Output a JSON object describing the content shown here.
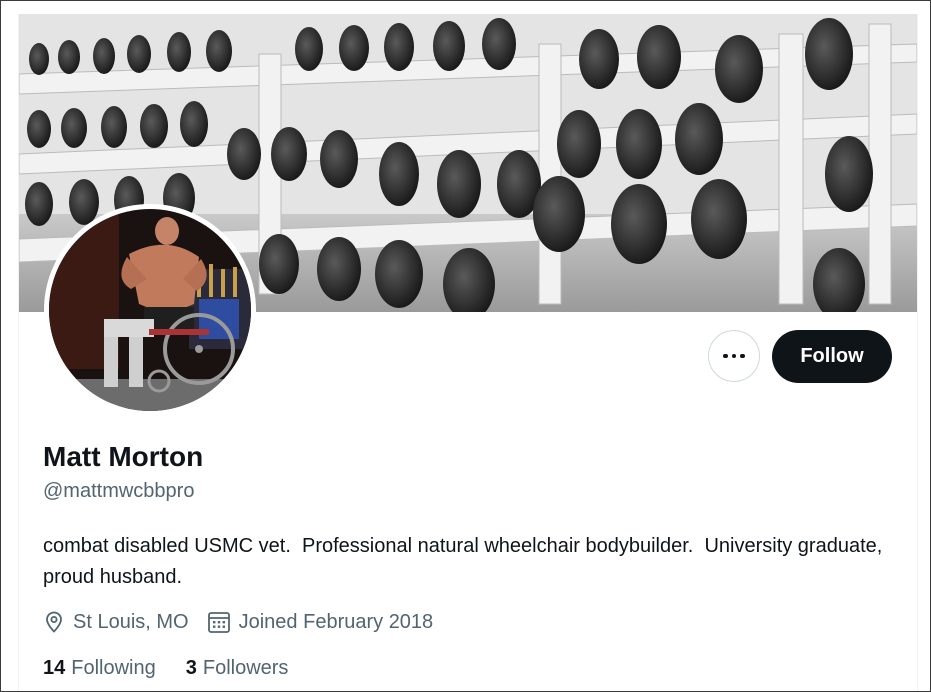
{
  "profile": {
    "display_name": "Matt Morton",
    "handle": "@mattmwcbbpro",
    "bio": "combat disabled USMC vet.  Professional natural wheelchair bodybuilder.  University graduate, proud husband.",
    "location": "St Louis, MO",
    "joined": "Joined February 2018",
    "following_count": "14",
    "following_label": "Following",
    "followers_count": "3",
    "followers_label": "Followers"
  },
  "actions": {
    "follow_label": "Follow",
    "more_icon": "more-horizontal-icon"
  },
  "icons": {
    "location": "location-pin-icon",
    "calendar": "calendar-icon"
  },
  "colors": {
    "follow_bg": "#0f1419",
    "secondary_text": "#536471",
    "primary_text": "#0f1419"
  }
}
